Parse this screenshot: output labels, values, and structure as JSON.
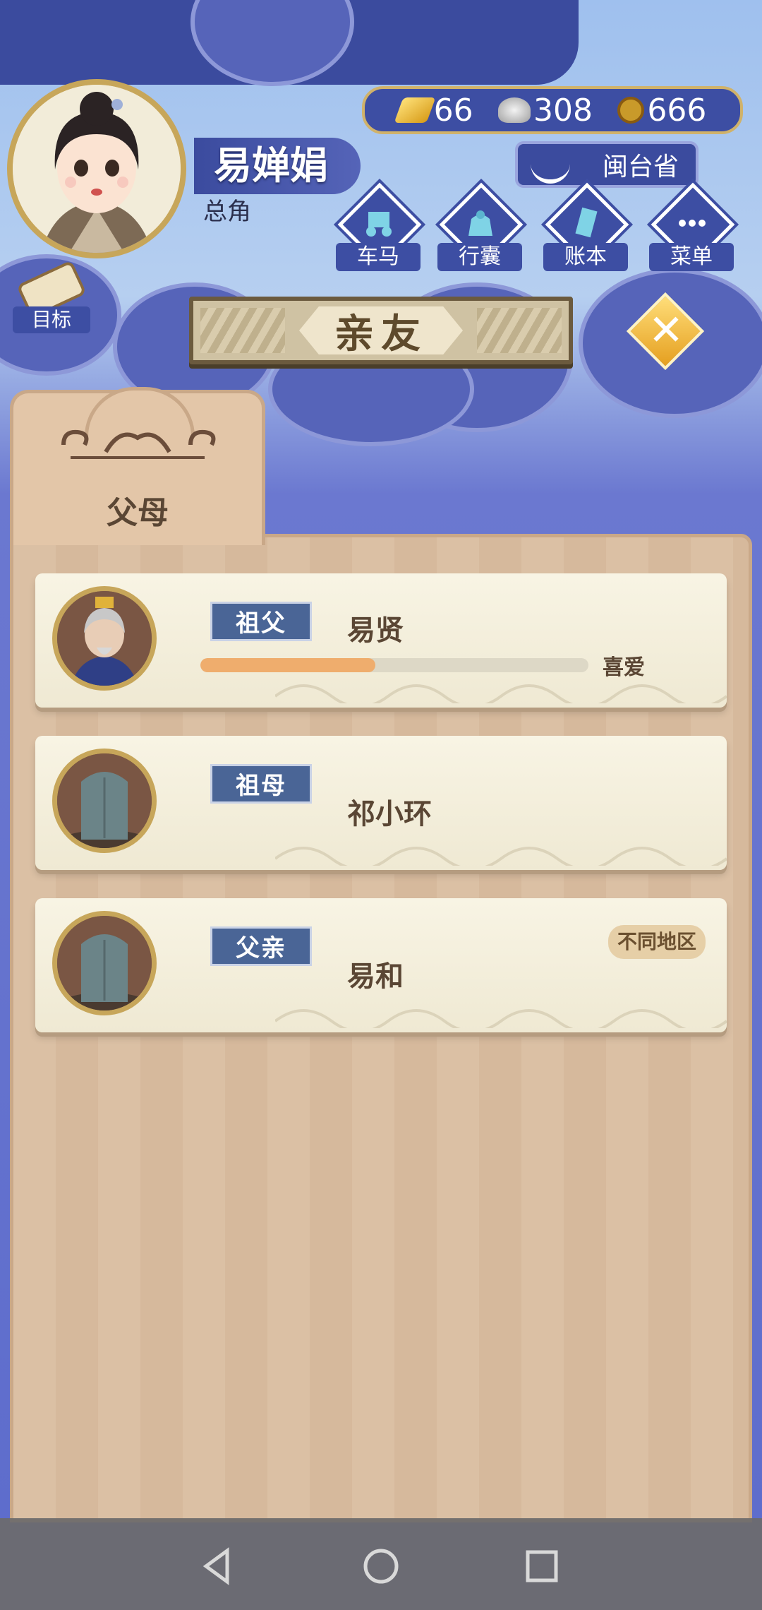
{
  "player": {
    "name": "易婵娟",
    "role": "总角"
  },
  "currencies": {
    "gold": "66",
    "silver": "308",
    "copper": "666"
  },
  "location": {
    "province": "闽台省"
  },
  "nav": {
    "items": [
      {
        "label": "车马",
        "icon": "carriage-icon"
      },
      {
        "label": "行囊",
        "icon": "bag-icon"
      },
      {
        "label": "账本",
        "icon": "ledger-icon"
      },
      {
        "label": "菜单",
        "icon": "menu-icon"
      }
    ],
    "goal_label": "目标"
  },
  "page": {
    "title": "亲友",
    "active_tab": "父母"
  },
  "relatives": [
    {
      "relation": "祖父",
      "name": "易贤",
      "affection_fraction": 0.45,
      "affection_label": "喜爱",
      "portrait": "elderly-man-avatar"
    },
    {
      "relation": "祖母",
      "name": "祁小环",
      "portrait": "tombstone-icon"
    },
    {
      "relation": "父亲",
      "name": "易和",
      "region_tag": "不同地区",
      "portrait": "tombstone-icon"
    }
  ],
  "colors": {
    "accent_blue": "#3d4ea3",
    "badge_blue": "#4a6596",
    "affection_fill": "#efad6d",
    "gold_border": "#c7a65a"
  }
}
